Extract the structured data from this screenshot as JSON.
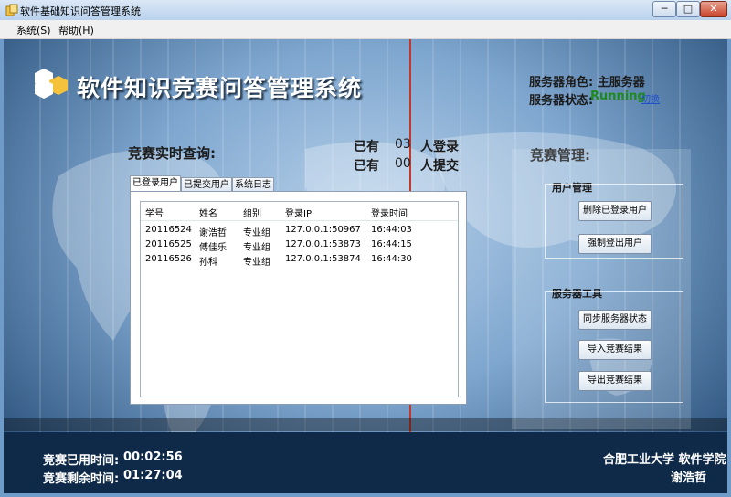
{
  "window": {
    "title": "软件基础知识问答管理系统",
    "controls": {
      "minimize": "─",
      "maximize": "□",
      "close": "✕"
    }
  },
  "menu": {
    "items": [
      "系统(S)",
      "帮助(H)"
    ]
  },
  "header": {
    "app_title": "软件知识竞赛问答管理系统",
    "server_role": "服务器角色: 主服务器",
    "server_status_label": "服务器状态:",
    "server_status_value": "Running",
    "switch_link": "切换"
  },
  "live": {
    "title": "竞赛实时查询:",
    "logged_prefix": "已有",
    "logged_count": "03",
    "logged_suffix": "人登录",
    "submitted_prefix": "已有",
    "submitted_count": "00",
    "submitted_suffix": "人提交"
  },
  "tabs": [
    "已登录用户",
    "已提交用户",
    "系统日志"
  ],
  "table": {
    "columns": [
      "学号",
      "姓名",
      "组别",
      "登录IP",
      "登录时间"
    ],
    "rows": [
      [
        "20116524",
        "谢浩哲",
        "专业组",
        "127.0.0.1:50967",
        "16:44:03"
      ],
      [
        "20116525",
        "傅佳乐",
        "专业组",
        "127.0.0.1:53873",
        "16:44:15"
      ],
      [
        "20116526",
        "孙科",
        "专业组",
        "127.0.0.1:53874",
        "16:44:30"
      ]
    ]
  },
  "management": {
    "title": "竞赛管理:",
    "user_group": {
      "title": "用户管理",
      "buttons": [
        "删除已登录用户",
        "强制登出用户"
      ]
    },
    "server_group": {
      "title": "服务器工具",
      "buttons": [
        "同步服务器状态",
        "导入竞赛结果",
        "导出竞赛结果"
      ]
    }
  },
  "timers": {
    "used_label": "竞赛已用时间:",
    "used_value": "00:02:56",
    "remaining_label": "竞赛剩余时间:",
    "remaining_value": "01:27:04"
  },
  "footer": {
    "org": "合肥工业大学 软件学院",
    "author": "谢浩哲"
  },
  "colors": {
    "status_running": "#1e8a1e",
    "link": "#2050c8",
    "title_text": "#ffffff"
  },
  "icons": [
    "app-icon",
    "logo-cubes-icon",
    "minimize-icon",
    "maximize-icon",
    "close-icon"
  ]
}
